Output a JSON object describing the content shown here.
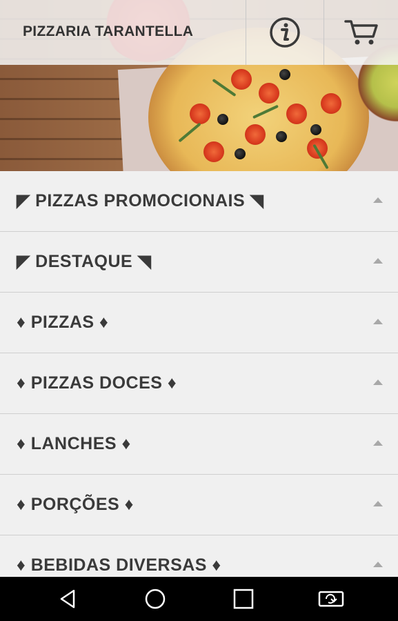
{
  "app": {
    "title": "PIZZARIA TARANTELLA"
  },
  "header_icons": {
    "info": "info-icon",
    "cart": "cart-icon"
  },
  "categories": [
    {
      "label": "◤ PIZZAS PROMOCIONAIS ◥"
    },
    {
      "label": "◤ DESTAQUE ◥"
    },
    {
      "label": "♦ PIZZAS ♦"
    },
    {
      "label": "♦ PIZZAS DOCES ♦"
    },
    {
      "label": "♦ LANCHES ♦"
    },
    {
      "label": "♦ PORÇÕES ♦"
    },
    {
      "label": "♦ BEBIDAS DIVERSAS ♦"
    }
  ],
  "nav": {
    "back": "back-icon",
    "home": "home-icon",
    "recents": "recents-icon",
    "rotate": "rotate-icon"
  },
  "colors": {
    "list_background": "#f0f0f0",
    "text": "#3a3a3a",
    "nav_bar": "#000000"
  }
}
